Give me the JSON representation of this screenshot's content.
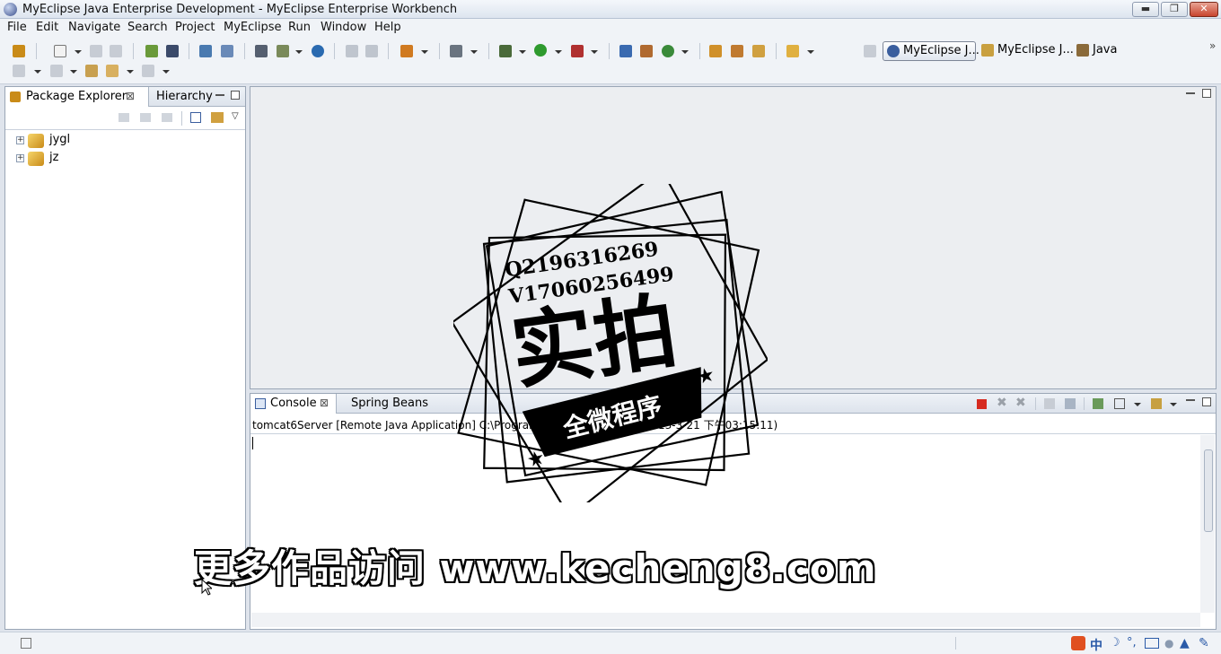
{
  "window": {
    "title": "MyEclipse Java Enterprise Development - MyEclipse Enterprise Workbench",
    "min_glyph": "▬",
    "restore_glyph": "❐",
    "close_glyph": "✕"
  },
  "menu": [
    "File",
    "Edit",
    "Navigate",
    "Search",
    "Project",
    "MyEclipse",
    "Run",
    "Window",
    "Help"
  ],
  "perspectives": [
    {
      "label": "MyEclipse J...",
      "active": true
    },
    {
      "label": "MyEclipse J...",
      "active": false
    },
    {
      "label": "Java",
      "active": false
    }
  ],
  "package_explorer": {
    "tabs": [
      {
        "label": "Package Explorer",
        "active": true,
        "closable": true
      },
      {
        "label": "Hierarchy",
        "active": false,
        "closable": false
      }
    ],
    "projects": [
      "jygl",
      "jz"
    ]
  },
  "console": {
    "tabs": [
      {
        "label": "Console",
        "active": true,
        "closable": true
      },
      {
        "label": "Spring Beans",
        "active": false,
        "closable": false
      }
    ],
    "process_line": "tomcat6Server [Remote Java Application] C:\\Program Files\\... javaw.exe (2013-3-21 下午03:15:11)"
  },
  "watermark": {
    "qq": "Q2196316269",
    "wechat": "V17060256499",
    "main": "实拍",
    "ribbon": "全微程序",
    "footer": "更多作品访问 www.kecheng8.com"
  },
  "colors": {
    "accent": "#3a5e9e",
    "stop": "#d62a1f",
    "run": "#2e9a2e"
  }
}
